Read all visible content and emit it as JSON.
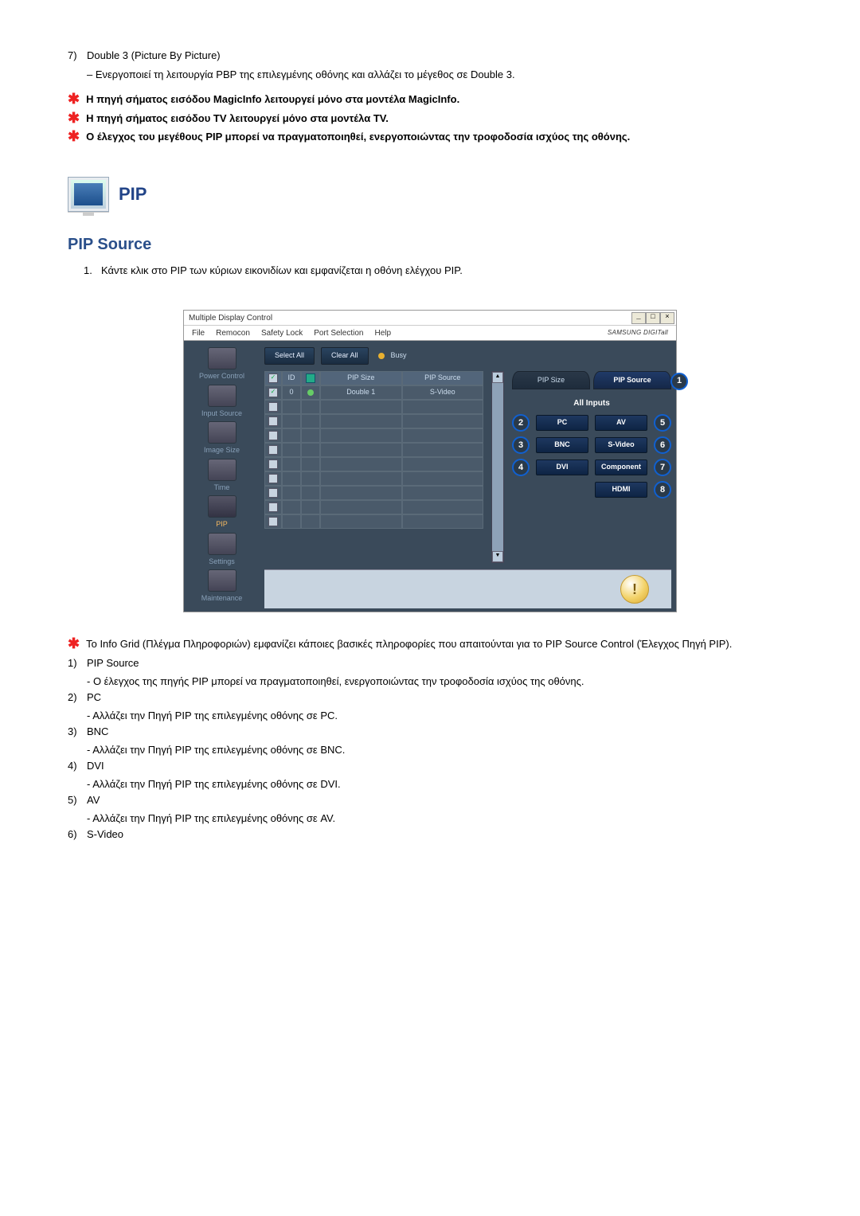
{
  "intro": {
    "num7": "7)",
    "item7": "Double 3 (Picture By Picture)",
    "item7_sub": "– Ενεργοποιεί τη λειτουργία PBP της επιλεγμένης οθόνης και αλλάζει το μέγεθος σε Double 3.",
    "note1": "Η πηγή σήματος εισόδου MagicInfo λειτουργεί μόνο στα μοντέλα MagicInfo.",
    "note2": "Η πηγή σήματος εισόδου TV λειτουργεί μόνο στα μοντέλα TV.",
    "note3": "Ο έλεγχος του μεγέθους PIP μπορεί να πραγματοποιηθεί, ενεργοποιώντας την τροφοδοσία ισχύος της οθόνης."
  },
  "section": {
    "title": "PIP",
    "subtitle": "PIP Source",
    "step1_num": "1.",
    "step1": "Κάντε κλικ στο PIP των κύριων εικονιδίων και εμφανίζεται η οθόνη ελέγχου PIP."
  },
  "app": {
    "title": "Multiple Display Control",
    "menu": {
      "file": "File",
      "remocon": "Remocon",
      "safety": "Safety Lock",
      "port": "Port Selection",
      "help": "Help"
    },
    "brand": "SAMSUNG DIGITall",
    "select_all": "Select All",
    "clear_all": "Clear All",
    "busy": "Busy",
    "side": {
      "power": "Power Control",
      "input": "Input Source",
      "imgsize": "Image Size",
      "time": "Time",
      "pip": "PIP",
      "settings": "Settings",
      "maint": "Maintenance"
    },
    "grid": {
      "h_id": "ID",
      "h_size": "PIP Size",
      "h_src": "PIP Source",
      "r1_id": "0",
      "r1_size": "Double 1",
      "r1_src": "S-Video"
    },
    "tabs": {
      "size": "PIP Size",
      "source": "PIP Source"
    },
    "all_inputs": "All Inputs",
    "inputs": {
      "pc": "PC",
      "av": "AV",
      "bnc": "BNC",
      "svideo": "S-Video",
      "dvi": "DVI",
      "component": "Component",
      "hdmi": "HDMI"
    },
    "nums": {
      "n1": "1",
      "n2": "2",
      "n3": "3",
      "n4": "4",
      "n5": "5",
      "n6": "6",
      "n7": "7",
      "n8": "8"
    }
  },
  "notes_after": {
    "info_grid": "Το Info Grid (Πλέγμα Πληροφοριών) εμφανίζει κάποιες βασικές πληροφορίες που απαιτούνται για το PIP Source Control (Έλεγχος Πηγή PIP).",
    "l1n": "1)",
    "l1t": "PIP Source",
    "l1d": "- Ο έλεγχος της πηγής PIP μπορεί να πραγματοποιηθεί, ενεργοποιώντας την τροφοδοσία ισχύος της οθόνης.",
    "l2n": "2)",
    "l2t": "PC",
    "l2d": "- Αλλάζει την Πηγή PIP της επιλεγμένης οθόνης σε PC.",
    "l3n": "3)",
    "l3t": "BNC",
    "l3d": "- Αλλάζει την Πηγή PIP της επιλεγμένης οθόνης σε BNC.",
    "l4n": "4)",
    "l4t": "DVI",
    "l4d": "- Αλλάζει την Πηγή PIP της επιλεγμένης οθόνης σε DVI.",
    "l5n": "5)",
    "l5t": "AV",
    "l5d": "- Αλλάζει την Πηγή PIP της επιλεγμένης οθόνης σε AV.",
    "l6n": "6)",
    "l6t": "S-Video"
  }
}
